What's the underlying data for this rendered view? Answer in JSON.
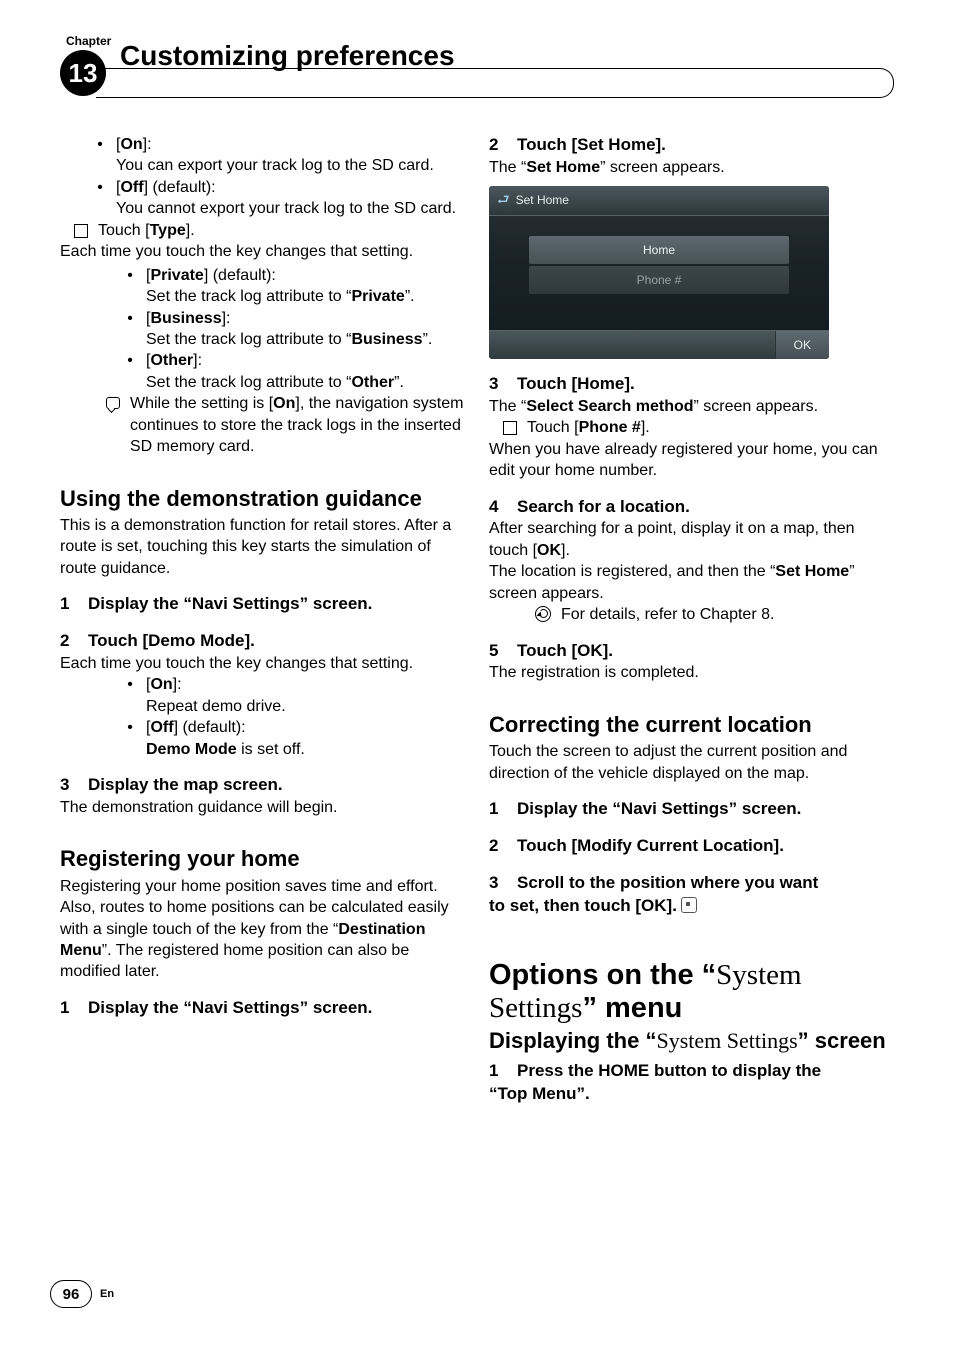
{
  "chapter": {
    "label": "Chapter",
    "number": "13",
    "title": "Customizing preferences"
  },
  "left": {
    "on_label": "On",
    "on_text": "You can export your track log to the SD card.",
    "off_label": "Off",
    "off_default": " (default):",
    "off_text": "You cannot export your track log to the SD card.",
    "touch_type_pre": "Touch [",
    "touch_type_bold": "Type",
    "touch_type_post": "].",
    "each_time": "Each time you touch the key changes that setting.",
    "private_label": "Private",
    "private_default": " (default):",
    "private_text_pre": "Set the track log attribute to “",
    "private_text_bold": "Private",
    "private_text_post": "”.",
    "business_label": "Business",
    "business_text_pre": "Set the track log attribute to “",
    "business_text_bold": "Business",
    "business_text_post": "”.",
    "other_label": "Other",
    "other_text_pre": "Set the track log attribute to “",
    "other_text_bold": "Other",
    "other_text_post": "”.",
    "note_pre": "While the setting is [",
    "note_bold": "On",
    "note_post": "], the navigation system continues to store the track logs in the inserted SD memory card.",
    "demo_heading": "Using the demonstration guidance",
    "demo_intro": "This is a demonstration function for retail stores. After a route is set, touching this key starts the simulation of route guidance.",
    "demo_step1": "Display the “Navi Settings” screen.",
    "demo_step2": "Touch [Demo Mode].",
    "demo_each": "Each time you touch the key changes that setting.",
    "demo_on_label": "On",
    "demo_on_text": "Repeat demo drive.",
    "demo_off_label": "Off",
    "demo_off_default": " (default):",
    "demo_off_text_bold": "Demo Mode",
    "demo_off_text_rest": " is set off.",
    "demo_step3": "Display the map screen.",
    "demo_begin": "The demonstration guidance will begin.",
    "home_heading": "Registering your home",
    "home_intro_pre": "Registering your home position saves time and effort. Also, routes to home positions can be calculated easily with a single touch of the key from the “",
    "home_intro_bold": "Destination Menu",
    "home_intro_post": "”. The registered home position can also be modified later.",
    "home_step1": "Display the “Navi Settings” screen."
  },
  "right": {
    "step2": "Touch [Set Home].",
    "step2_text_pre": "The “",
    "step2_text_bold": "Set Home",
    "step2_text_post": "” screen appears.",
    "shot": {
      "title": "Set Home",
      "row1": "Home",
      "row2": "Phone #",
      "ok": "OK"
    },
    "step3": "Touch [Home].",
    "step3_text_pre": "The “",
    "step3_text_bold": "Select Search method",
    "step3_text_post": "” screen appears.",
    "touch_phone_pre": "Touch [",
    "touch_phone_bold": "Phone #",
    "touch_phone_post": "].",
    "phone_desc": "When you have already registered your home, you can edit your home number.",
    "step4": "Search for a location.",
    "step4_p1_pre": "After searching for a point, display it on a map, then touch [",
    "step4_p1_bold": "OK",
    "step4_p1_post": "].",
    "step4_p2_pre": "The location is registered, and then the “",
    "step4_p2_bold": "Set Home",
    "step4_p2_post": "” screen appears.",
    "ref": "For details, refer to Chapter 8.",
    "step5": "Touch [OK].",
    "step5_text": "The registration is completed.",
    "correct_heading": "Correcting the current location",
    "correct_intro": "Touch the screen to adjust the current position and direction of the vehicle displayed on the map.",
    "correct_step1": "Display the “Navi Settings” screen.",
    "correct_step2": "Touch [Modify Current Location].",
    "correct_step3a": "Scroll to the position where you want",
    "correct_step3b": "to set, then touch [OK].",
    "options_heading_pre": "Options on the “",
    "options_heading_semi": "System Settings",
    "options_heading_post": "” menu",
    "display_heading_pre": "Displaying the “",
    "display_heading_semi": "System Settings",
    "display_heading_post": "” screen",
    "options_step1a": "Press the HOME button to display the",
    "options_step1b": "“Top Menu”."
  },
  "footer": {
    "page": "96",
    "lang": "En"
  }
}
